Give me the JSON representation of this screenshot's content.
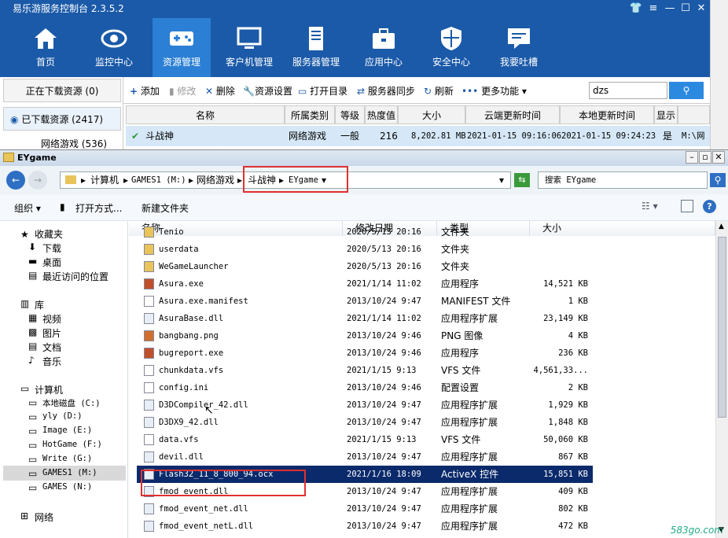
{
  "app": {
    "title": "易乐游服务控制台 2.3.5.2",
    "nav": [
      {
        "label": "首页",
        "icon": "home-icon"
      },
      {
        "label": "监控中心",
        "icon": "eye-icon"
      },
      {
        "label": "资源管理",
        "icon": "gamepad-icon",
        "active": true
      },
      {
        "label": "客户机管理",
        "icon": "monitor-icon"
      },
      {
        "label": "服务器管理",
        "icon": "server-icon"
      },
      {
        "label": "应用中心",
        "icon": "toolbox-icon"
      },
      {
        "label": "安全中心",
        "icon": "shield-icon"
      },
      {
        "label": "我要吐槽",
        "icon": "chat-icon"
      }
    ],
    "left": {
      "downloading": "正在下载资源 (0)",
      "downloaded": "已下载资源 (2417)",
      "netgames": "网络游戏 (536)"
    },
    "toolbar": {
      "add": "添加",
      "edit": "修改",
      "delete": "删除",
      "res_settings": "资源设置",
      "open_dir": "打开目录",
      "server_sync": "服务器同步",
      "refresh": "刷新",
      "more": "更多功能",
      "search_value": "dzs"
    },
    "table": {
      "headers": [
        "名称",
        "所属类别",
        "等级",
        "热度值",
        "大小",
        "云端更新时间",
        "本地更新时间",
        "显示"
      ],
      "row": {
        "name": "斗战神",
        "category": "网络游戏",
        "level": "一般",
        "heat": "216",
        "size": "8,202.81 MB",
        "cloud_time": "2021-01-15 09:16:06",
        "local_time": "2021-01-15 09:24:23",
        "show": "是",
        "path": "M:\\网"
      }
    }
  },
  "explorer": {
    "title": "EYgame",
    "breadcrumb": [
      "计算机",
      "GAMES1 (M:)",
      "网络游戏",
      "斗战神",
      "EYgame"
    ],
    "search_placeholder": "搜索 EYgame",
    "cmd": {
      "organize": "组织",
      "open_with": "打开方式...",
      "new_folder": "新建文件夹"
    },
    "nav": {
      "favorites": "收藏夹",
      "downloads": "下载",
      "desktop": "桌面",
      "recent": "最近访问的位置",
      "libraries": "库",
      "videos": "视频",
      "pictures": "图片",
      "documents": "文档",
      "music": "音乐",
      "computer": "计算机",
      "drives": [
        "本地磁盘 (C:)",
        "yly (D:)",
        "Image (E:)",
        "HotGame (F:)",
        "Write (G:)",
        "GAMES1 (M:)",
        "GAMES (N:)"
      ],
      "network": "网络"
    },
    "columns": [
      "名称",
      "修改日期",
      "类型",
      "大小"
    ],
    "files": [
      {
        "name": "Tenio",
        "date": "2020/5/13 20:16",
        "type": "文件夹",
        "size": "",
        "icon": "folder-icon"
      },
      {
        "name": "userdata",
        "date": "2020/5/13 20:16",
        "type": "文件夹",
        "size": "",
        "icon": "folder-icon"
      },
      {
        "name": "WeGameLauncher",
        "date": "2020/5/13 20:16",
        "type": "文件夹",
        "size": "",
        "icon": "folder-icon"
      },
      {
        "name": "Asura.exe",
        "date": "2021/1/14 11:02",
        "type": "应用程序",
        "size": "14,521 KB",
        "icon": "exe-icon"
      },
      {
        "name": "Asura.exe.manifest",
        "date": "2013/10/24 9:47",
        "type": "MANIFEST 文件",
        "size": "1 KB",
        "icon": "file-icon"
      },
      {
        "name": "AsuraBase.dll",
        "date": "2021/1/14 11:02",
        "type": "应用程序扩展",
        "size": "23,149 KB",
        "icon": "dll-icon"
      },
      {
        "name": "bangbang.png",
        "date": "2013/10/24 9:46",
        "type": "PNG 图像",
        "size": "4 KB",
        "icon": "image-icon"
      },
      {
        "name": "bugreport.exe",
        "date": "2013/10/24 9:46",
        "type": "应用程序",
        "size": "236 KB",
        "icon": "exe-icon"
      },
      {
        "name": "chunkdata.vfs",
        "date": "2021/1/15 9:13",
        "type": "VFS 文件",
        "size": "4,561,33...",
        "icon": "file-icon"
      },
      {
        "name": "config.ini",
        "date": "2013/10/24 9:46",
        "type": "配置设置",
        "size": "2 KB",
        "icon": "file-icon"
      },
      {
        "name": "D3DCompiler_42.dll",
        "date": "2013/10/24 9:47",
        "type": "应用程序扩展",
        "size": "1,929 KB",
        "icon": "dll-icon"
      },
      {
        "name": "D3DX9_42.dll",
        "date": "2013/10/24 9:47",
        "type": "应用程序扩展",
        "size": "1,848 KB",
        "icon": "dll-icon"
      },
      {
        "name": "data.vfs",
        "date": "2021/1/15 9:13",
        "type": "VFS 文件",
        "size": "50,060 KB",
        "icon": "file-icon"
      },
      {
        "name": "devil.dll",
        "date": "2013/10/24 9:47",
        "type": "应用程序扩展",
        "size": "867 KB",
        "icon": "dll-icon"
      },
      {
        "name": "Flash32_11_8_800_94.ocx",
        "date": "2021/1/16 18:09",
        "type": "ActiveX 控件",
        "size": "15,851 KB",
        "icon": "dll-icon",
        "selected": true
      },
      {
        "name": "fmod_event.dll",
        "date": "2013/10/24 9:47",
        "type": "应用程序扩展",
        "size": "409 KB",
        "icon": "dll-icon"
      },
      {
        "name": "fmod_event_net.dll",
        "date": "2013/10/24 9:47",
        "type": "应用程序扩展",
        "size": "802 KB",
        "icon": "dll-icon"
      },
      {
        "name": "fmod_event_netL.dll",
        "date": "2013/10/24 9:47",
        "type": "应用程序扩展",
        "size": "472 KB",
        "icon": "dll-icon"
      }
    ]
  },
  "watermark": "583go.com",
  "colors": {
    "nav_bg": "#1b5aa8",
    "nav_active": "#2b7fd4",
    "selection": "#0b2a6b",
    "highlight_box": "#e03030"
  }
}
